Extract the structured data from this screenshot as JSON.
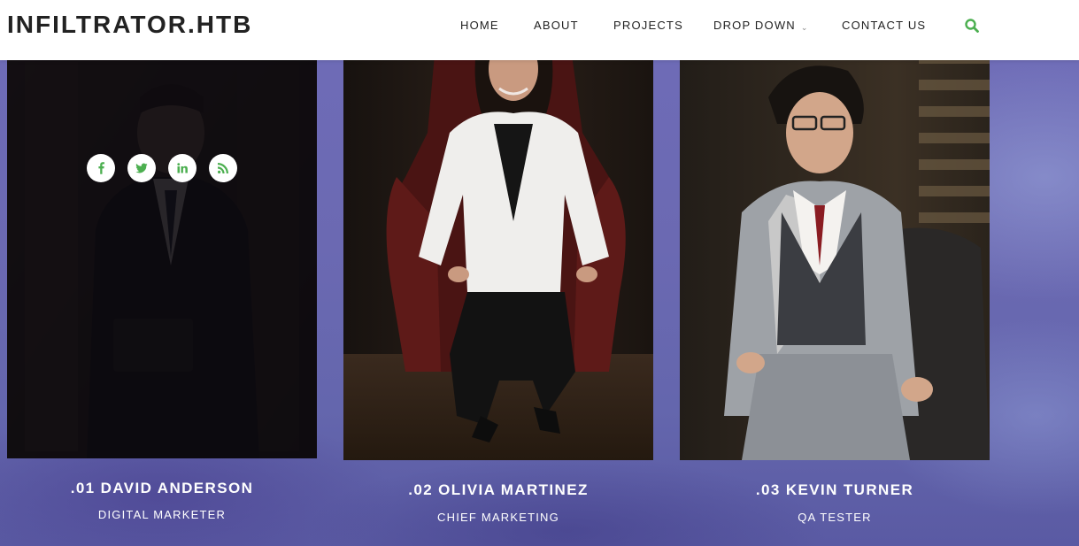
{
  "header": {
    "brand": "INFILTRATOR.HTB",
    "nav": [
      {
        "label": "HOME"
      },
      {
        "label": "ABOUT"
      },
      {
        "label": "PROJECTS"
      },
      {
        "label": "DROP DOWN",
        "dropdown": true
      },
      {
        "label": "CONTACT US"
      }
    ],
    "search_icon": "search-icon",
    "accent_color": "#4caf50"
  },
  "team": [
    {
      "name": ".01 DAVID ANDERSON",
      "role": "DIGITAL MARKETER",
      "photo": "portrait of man in dark suit (dimmed by hover overlay)",
      "socials": [
        "facebook-icon",
        "twitter-icon",
        "linkedin-icon",
        "rss-icon"
      ]
    },
    {
      "name": ".02 OLIVIA MARTINEZ",
      "role": "CHIEF MARKETING",
      "photo": "portrait of woman in white blazer seated in red leather chair"
    },
    {
      "name": ".03 KEVIN TURNER",
      "role": "QA TESTER",
      "photo": "portrait of man in grey vest and glasses seated"
    }
  ],
  "colors": {
    "background": "#6b69b2",
    "social_icon": "#4caf50",
    "text_light": "#ffffff"
  }
}
